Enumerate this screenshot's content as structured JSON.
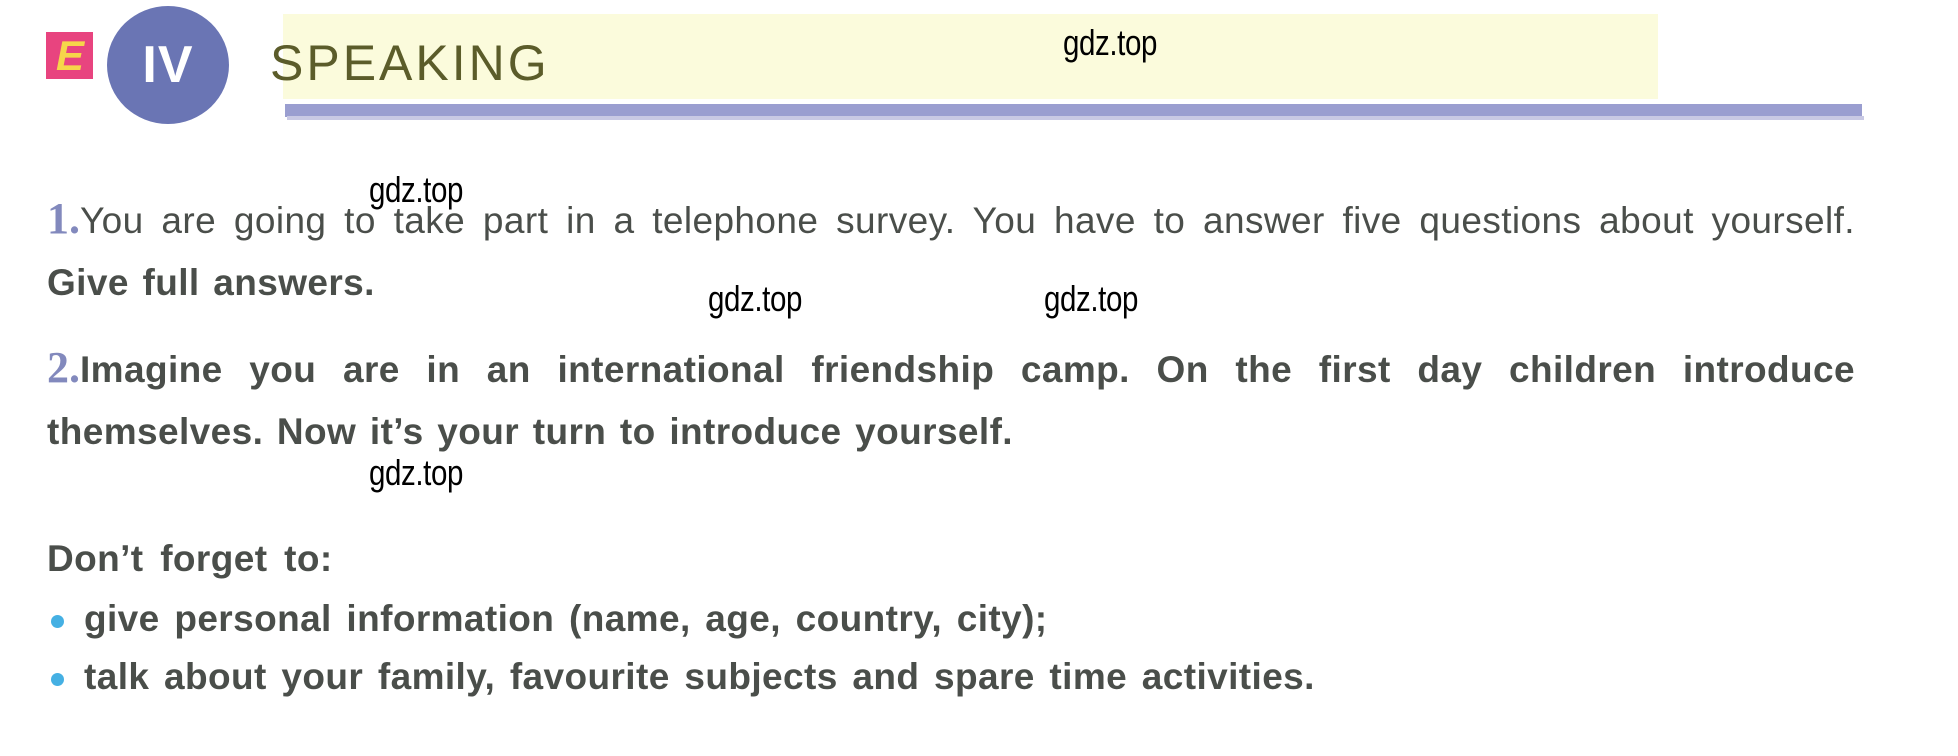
{
  "header": {
    "logo_letter": "E",
    "badge_numeral": "IV",
    "section_title": "SPEAKING",
    "banner_color": "#fbfbdc",
    "rule_color": "#9a9ed0",
    "badge_color": "#6a75b4",
    "title_color": "#5b5c2a",
    "logo_bg_color": "#e8447f",
    "logo_glyph_color": "#f6d64a"
  },
  "tasks": [
    {
      "number": "1.",
      "text_regular": "You are going to take part in a telephone survey. You have to answer five questions about yourself. ",
      "text_bold": "Give full answers."
    },
    {
      "number": "2.",
      "text_bold": "Imagine you are in an international friendship camp. On the first day children introduce themselves. Now it’s your turn to introduce yourself.",
      "forget_label": "Don’t forget to:",
      "bullets": [
        "give personal information (name, age, country, city);",
        "talk about your family, favourite subjects and spare time activities."
      ]
    }
  ],
  "watermarks": [
    {
      "text": "gdz.top"
    },
    {
      "text": "gdz.top"
    },
    {
      "text": "gdz.top"
    },
    {
      "text": "gdz.top"
    },
    {
      "text": "gdz.top"
    }
  ],
  "colors": {
    "number_accent": "#8289bd",
    "bullet_accent": "#45b0e3",
    "body_text": "#4a4e4a"
  }
}
